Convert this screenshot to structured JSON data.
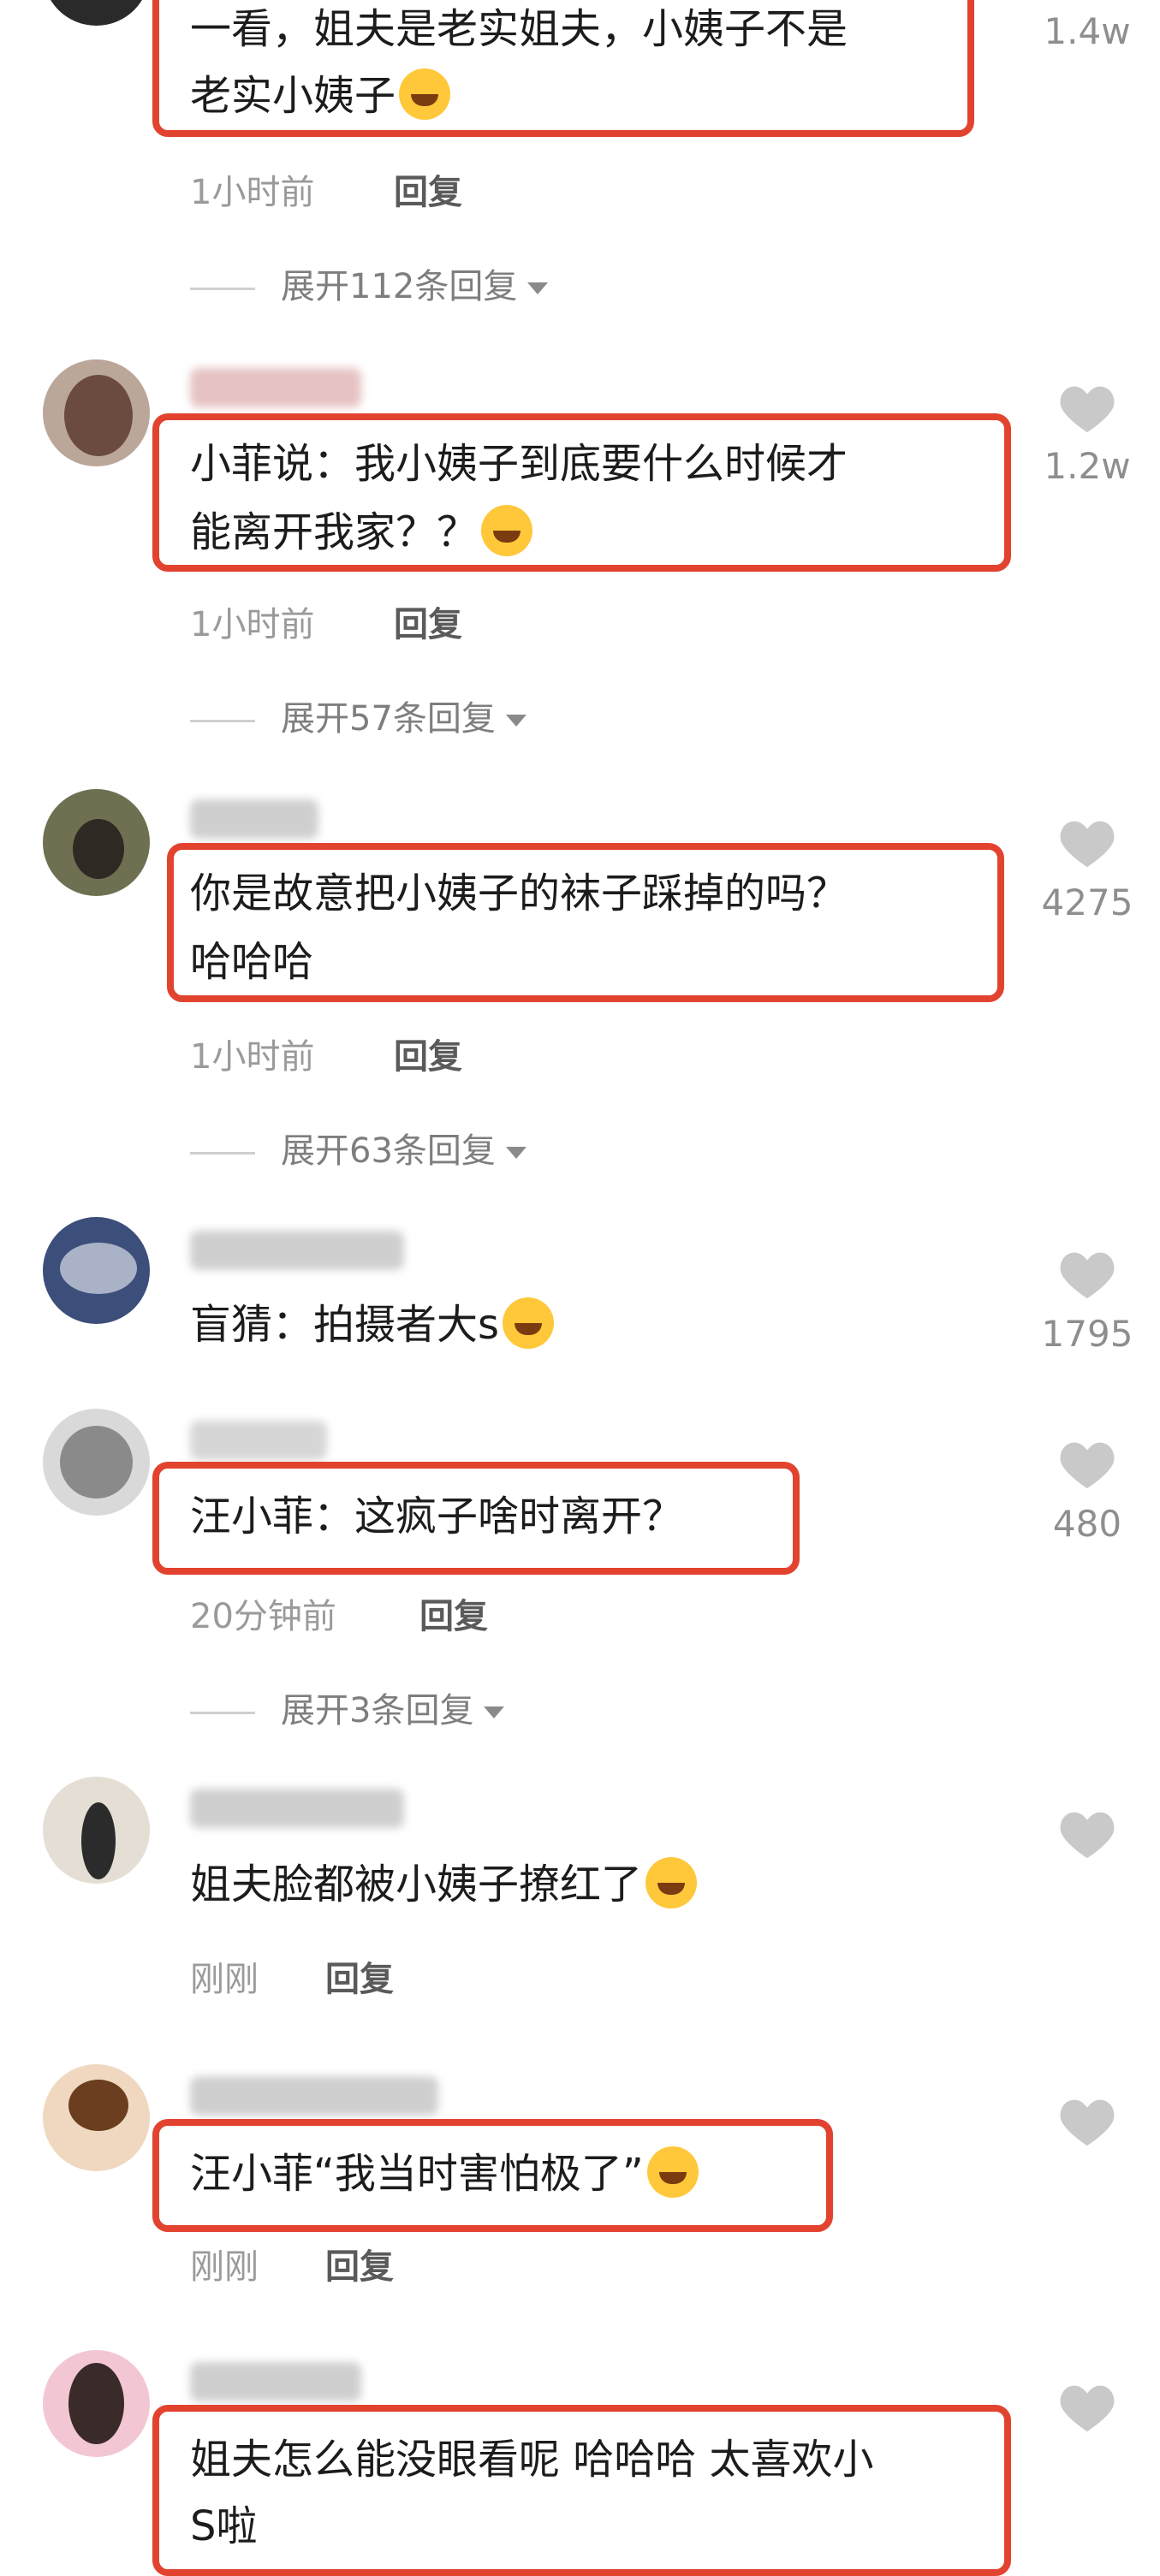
{
  "comments": [
    {
      "text_line1": "一看，姐夫是老实姐夫，小姨子不是",
      "text_line2": "老实小姨子",
      "likes": "1.4w",
      "time": "1小时前",
      "reply": "回复",
      "expand": "展开112条回复"
    },
    {
      "text_line1": "小菲说：我小姨子到底要什么时候才",
      "text_line2": "能离开我家？？",
      "likes": "1.2w",
      "time": "1小时前",
      "reply": "回复",
      "expand": "展开57条回复"
    },
    {
      "text_line1": "你是故意把小姨子的袜子踩掉的吗？",
      "text_line2": "哈哈哈",
      "likes": "4275",
      "time": "1小时前",
      "reply": "回复",
      "expand": "展开63条回复"
    },
    {
      "text_line1": "盲猜：拍摄者大s",
      "likes": "1795"
    },
    {
      "text_line1": "汪小菲：这疯子啥时离开？",
      "likes": "480",
      "time": "20分钟前",
      "reply": "回复",
      "expand": "展开3条回复"
    },
    {
      "text_line1": "姐夫脸都被小姨子撩红了",
      "time": "刚刚",
      "reply": "回复"
    },
    {
      "text_line1": "汪小菲“我当时害怕极了”",
      "time": "刚刚",
      "reply": "回复"
    },
    {
      "text_line1": "姐夫怎么能没眼看呢 哈哈哈 太喜欢小",
      "text_line2": "S啦"
    }
  ],
  "colors": {
    "highlight": "#e2432f",
    "like_icon": "#c9c9c9"
  }
}
